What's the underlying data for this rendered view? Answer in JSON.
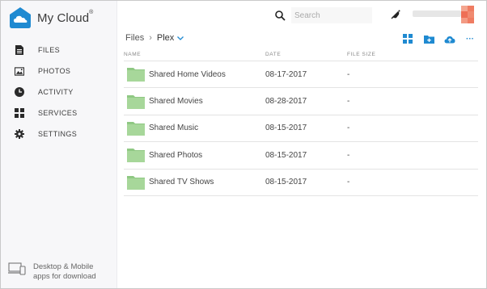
{
  "app": {
    "name": "My Cloud",
    "trademark": "®"
  },
  "colors": {
    "brand": "#1f8ad1",
    "folder": "#a7d79a",
    "folder_dark": "#8fc883",
    "text": "#444444"
  },
  "sidebar": {
    "items": [
      {
        "label": "FILES",
        "icon": "file-icon"
      },
      {
        "label": "PHOTOS",
        "icon": "photo-icon"
      },
      {
        "label": "ACTIVITY",
        "icon": "clock-icon"
      },
      {
        "label": "SERVICES",
        "icon": "grid-icon"
      },
      {
        "label": "SETTINGS",
        "icon": "gear-icon"
      }
    ],
    "download_line1": "Desktop & Mobile",
    "download_line2": "apps for download"
  },
  "search": {
    "placeholder": "Search"
  },
  "breadcrumb": {
    "root": "Files",
    "current": "Plex"
  },
  "toolbar": {
    "more_label": "···"
  },
  "table": {
    "headers": {
      "name": "NAME",
      "date": "DATE",
      "size": "FILE SIZE"
    },
    "rows": [
      {
        "name": "Shared Home Videos",
        "date": "08-17-2017",
        "size": "-"
      },
      {
        "name": "Shared Movies",
        "date": "08-28-2017",
        "size": "-"
      },
      {
        "name": "Shared Music",
        "date": "08-15-2017",
        "size": "-"
      },
      {
        "name": "Shared Photos",
        "date": "08-15-2017",
        "size": "-"
      },
      {
        "name": "Shared TV Shows",
        "date": "08-15-2017",
        "size": "-"
      }
    ]
  }
}
